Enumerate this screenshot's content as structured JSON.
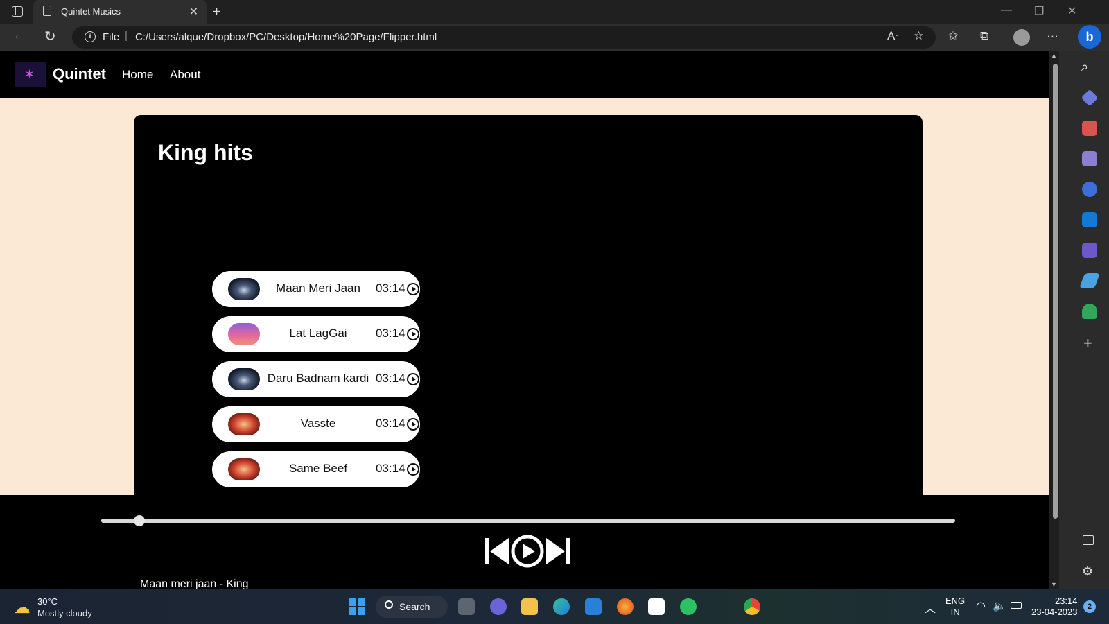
{
  "browser": {
    "tab_title": "Quintet Musics",
    "url_scheme": "File",
    "url": "C:/Users/alque/Dropbox/PC/Desktop/Home%20Page/Flipper.html"
  },
  "site": {
    "brand": "Quintet",
    "nav": [
      {
        "label": "Home"
      },
      {
        "label": "About"
      }
    ]
  },
  "card": {
    "title": "King hits",
    "songs": [
      {
        "name": "Maan Meri Jaan",
        "duration": "03:14",
        "thumb": "night-car"
      },
      {
        "name": "Lat LagGai",
        "duration": "03:14",
        "thumb": "sunset"
      },
      {
        "name": "Daru Badnam kardi",
        "duration": "03:14",
        "thumb": "night-car"
      },
      {
        "name": "Vasste",
        "duration": "03:14",
        "thumb": "red-portrait"
      },
      {
        "name": "Same Beef",
        "duration": "03:14",
        "thumb": "red-portrait"
      }
    ]
  },
  "player": {
    "progress_fraction": 0.045,
    "now_playing": "Maan meri jaan - King",
    "controls": [
      "previous-icon",
      "play-icon",
      "next-icon"
    ]
  },
  "taskbar": {
    "temperature": "30°C",
    "weather": "Mostly cloudy",
    "search_label": "Search",
    "lang_line1": "ENG",
    "lang_line2": "IN",
    "time": "23:14",
    "date": "23-04-2023",
    "notifications": "2"
  },
  "colors": {
    "page_bg": "#fbe9d5",
    "accent": "#000000",
    "edge_blue": "#1a67d6"
  }
}
